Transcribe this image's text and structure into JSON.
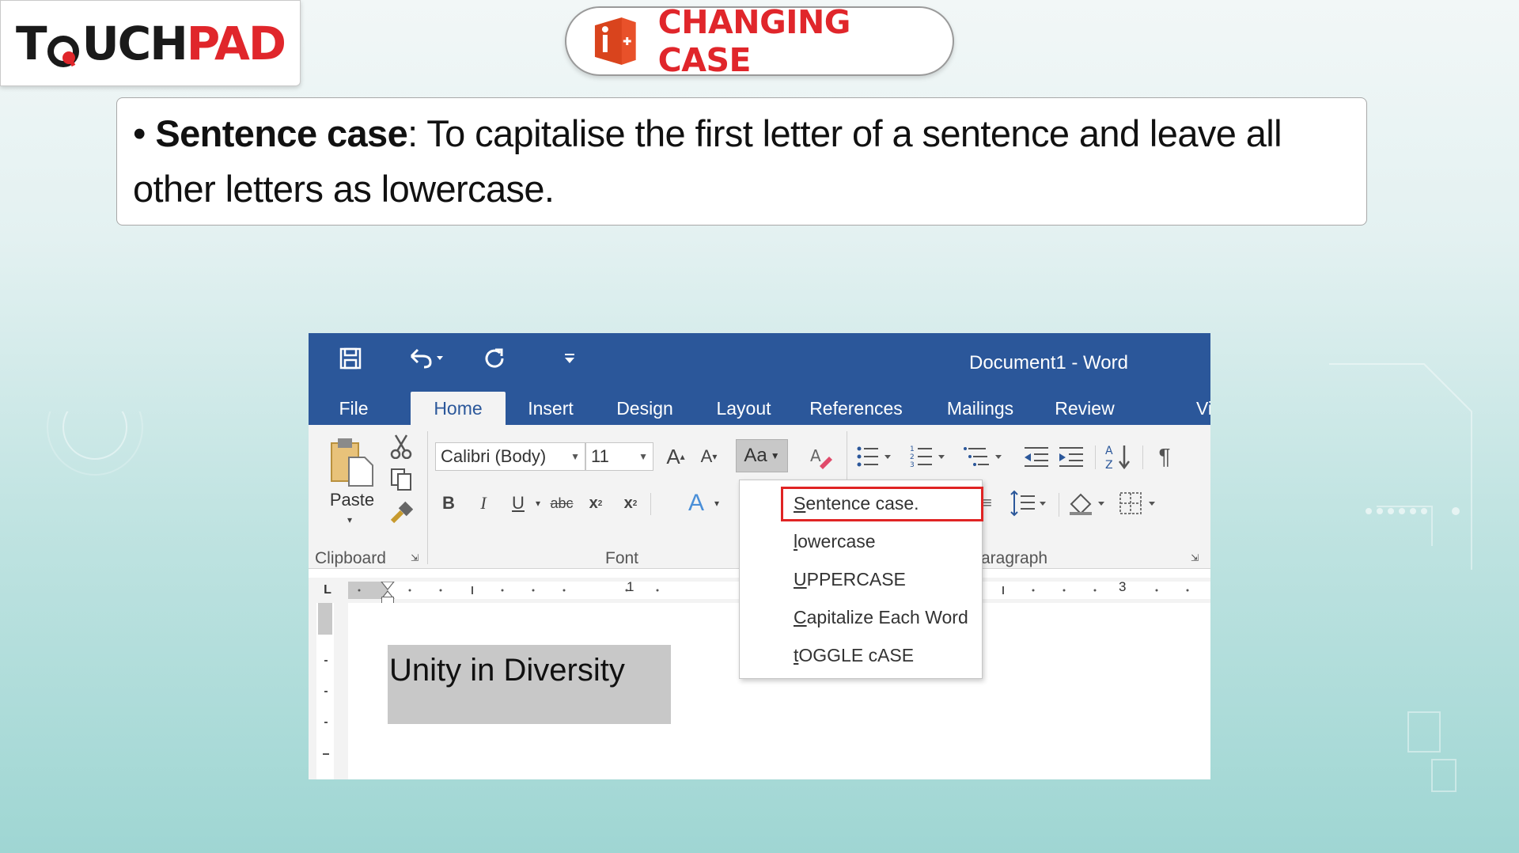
{
  "logo": {
    "text_left": "T",
    "text_mid": "UCH",
    "text_right": "PAD"
  },
  "title": {
    "text": "CHANGING CASE"
  },
  "definition": {
    "bullet": "•",
    "term": "Sentence case",
    "text": ": To capitalise the first letter of a sentence and leave all other letters as lowercase."
  },
  "word": {
    "window_title": "Document1 - Word",
    "tabs": [
      "File",
      "Home",
      "Insert",
      "Design",
      "Layout",
      "References",
      "Mailings",
      "Review",
      "Vi"
    ],
    "active_tab": "Home",
    "clipboard": {
      "paste_label": "Paste",
      "group_label": "Clipboard"
    },
    "font": {
      "name": "Calibri (Body)",
      "size": "11",
      "group_label": "Font",
      "case_button": "Aa"
    },
    "paragraph": {
      "group_label": "aragraph"
    },
    "ruler": {
      "mark_1": "1",
      "mark_3": "3",
      "tab_stop": "L"
    },
    "document_text": "Unity in Diversity",
    "change_case_menu": [
      {
        "underlined": "S",
        "rest": "entence case."
      },
      {
        "underlined": "l",
        "rest": "owercase"
      },
      {
        "underlined": "U",
        "rest": "PPERCASE"
      },
      {
        "underlined": "C",
        "rest": "apitalize Each Word"
      },
      {
        "underlined": "t",
        "rest": "OGGLE cASE"
      }
    ],
    "highlighted_option": "Sentence case."
  },
  "colors": {
    "brand_red": "#e0262b",
    "word_blue": "#2b579a",
    "highlight_border": "#e02424"
  }
}
